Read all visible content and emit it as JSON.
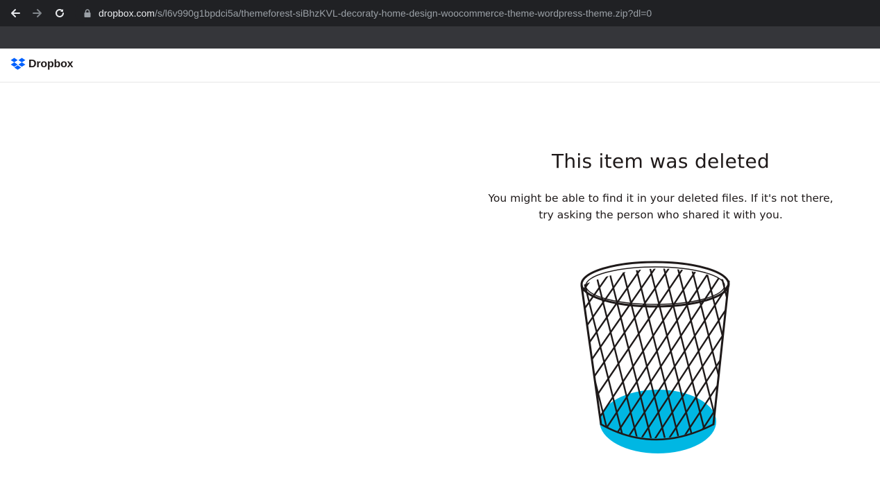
{
  "browser": {
    "url_host": "dropbox.com",
    "url_path": "/s/l6v990g1bpdci5a/themeforest-siBhzKVL-decoraty-home-design-woocommerce-theme-wordpress-theme.zip?dl=0",
    "icons": [
      "back-arrow-icon",
      "forward-arrow-icon",
      "reload-icon",
      "lock-icon"
    ]
  },
  "header": {
    "logo_text": "Dropbox",
    "brand_color": "#0061fe"
  },
  "main": {
    "title": "This item was deleted",
    "message_line1": "You might be able to find it in your deleted files. If it's not there,",
    "message_line2": "try asking the person who shared it with you."
  },
  "illustration": {
    "icon": "trash-basket-icon",
    "accent_color": "#00b7e3"
  }
}
